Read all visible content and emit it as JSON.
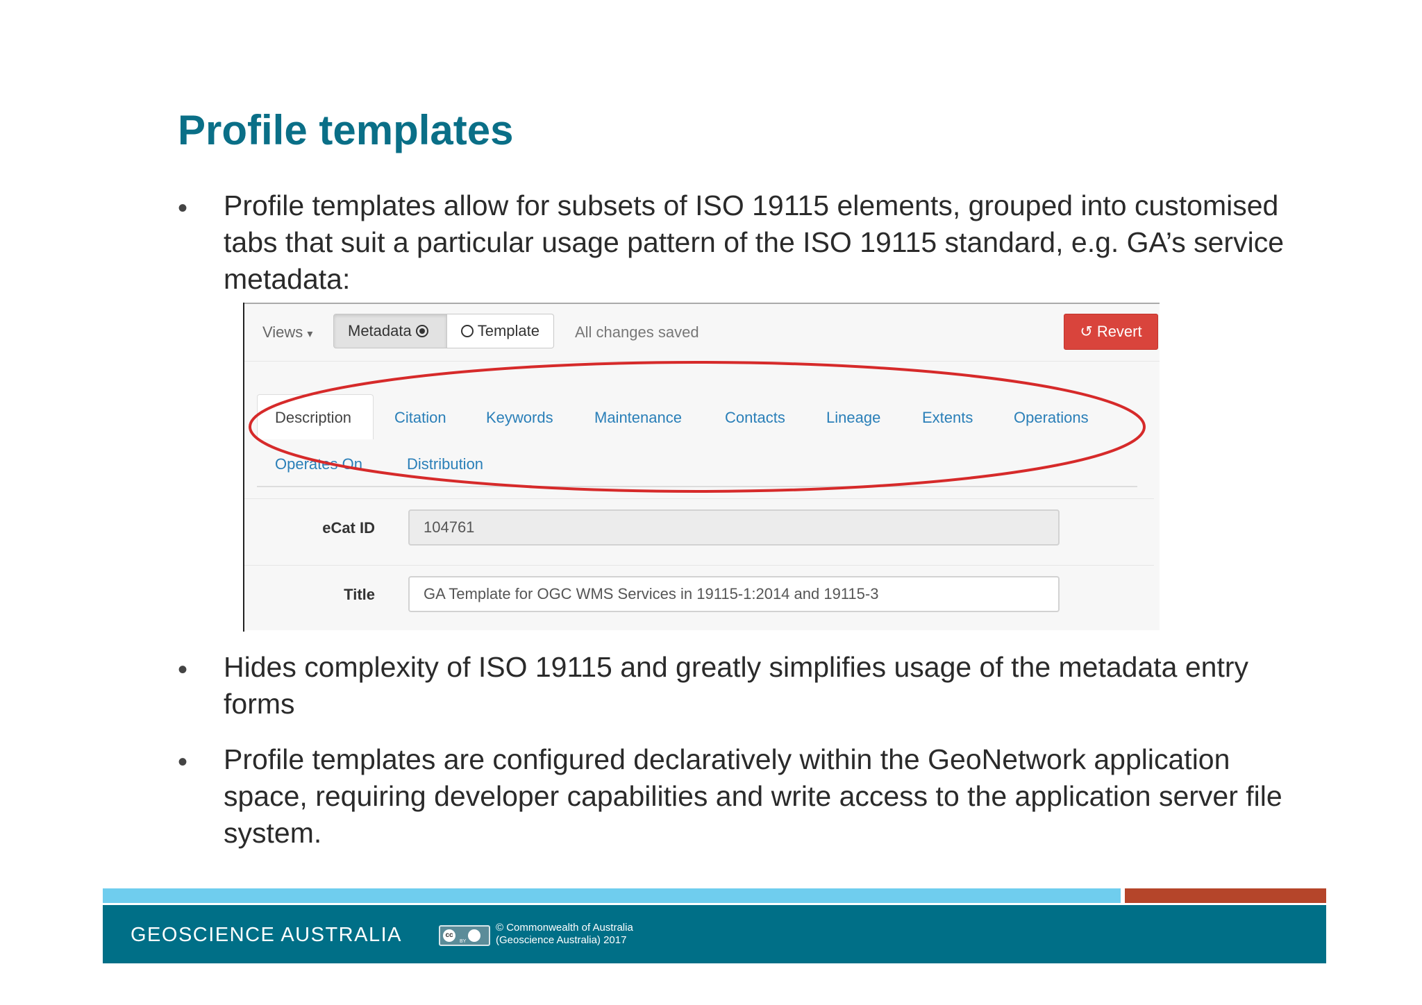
{
  "slide": {
    "title": "Profile templates",
    "bullet_glyph": "•",
    "bullets": [
      "Profile templates allow for subsets of ISO 19115 elements, grouped into customised tabs that suit a particular usage pattern of the ISO 19115 standard, e.g. GA’s service metadata:",
      "Hides complexity of ISO 19115 and greatly simplifies usage of the metadata entry forms",
      "Profile templates are configured declaratively within the GeoNetwork application space, requiring developer capabilities and write access to the application server file system."
    ]
  },
  "editor": {
    "views_label": "Views",
    "views_caret": "▾",
    "metadata_label": "Metadata",
    "template_label": "Template",
    "status": "All changes saved",
    "revert_label": "Revert",
    "revert_icon": "↺",
    "tabs": [
      "Description",
      "Citation",
      "Keywords",
      "Maintenance",
      "Contacts",
      "Lineage",
      "Extents",
      "Operations",
      "Operates On",
      "Distribution"
    ],
    "fields": [
      {
        "label": "eCat ID",
        "value": "104761"
      },
      {
        "label": "Title",
        "value": "GA Template for OGC WMS Services in 19115-1:2014 and 19115-3"
      }
    ],
    "highlight_color": "#d62a2a"
  },
  "footer": {
    "organization": "GEOSCIENCE AUSTRALIA",
    "cc_label": "cc",
    "cc_by": "BY",
    "copyright_line1": "© Commonwealth of Australia",
    "copyright_line2": "(Geoscience Australia) 2017",
    "band_blue": "#6fcdee",
    "band_orange": "#b5452a",
    "bar_color": "#006f87"
  }
}
